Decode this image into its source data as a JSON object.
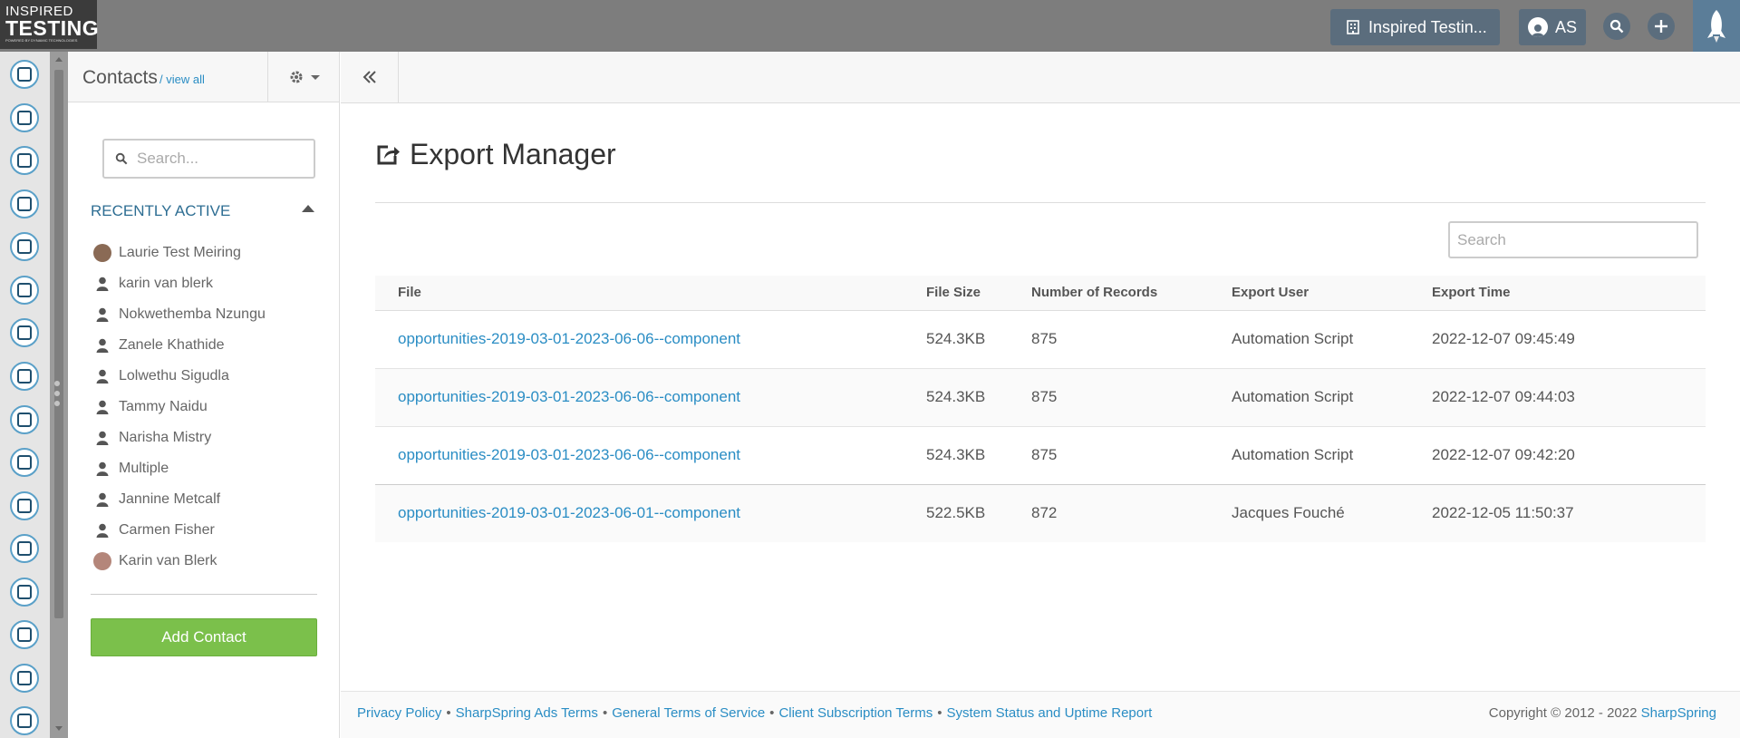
{
  "topbar": {
    "logo_line1": "INSPIRED",
    "logo_line2": "TESTING",
    "logo_tagline": "POWERED BY DYNAMIC TECHNOLOGIES",
    "org_label": "Inspired Testin...",
    "user_initials": "AS"
  },
  "rail": {
    "icons": [
      "contacts-icon",
      "email-icon",
      "clipboard-icon",
      "map-icon",
      "workflow-icon",
      "list-icon",
      "megaphone-icon",
      "chat-icon",
      "thumbs-up-icon",
      "tv-icon",
      "image-icon",
      "calendar-icon",
      "handshake-icon",
      "chart-icon",
      "support-icon",
      "user-settings-icon"
    ]
  },
  "contacts": {
    "title": "Contacts",
    "view_all": "/ view all",
    "search_placeholder": "Search...",
    "recent_heading": "RECENTLY ACTIVE",
    "recent": [
      {
        "name": "Laurie Test Meiring",
        "avatar": "photo"
      },
      {
        "name": "karin van blerk",
        "avatar": "person"
      },
      {
        "name": "Nokwethemba Nzungu",
        "avatar": "person"
      },
      {
        "name": "Zanele Khathide",
        "avatar": "person"
      },
      {
        "name": "Lolwethu Sigudla",
        "avatar": "person"
      },
      {
        "name": "Tammy Naidu",
        "avatar": "person"
      },
      {
        "name": "Narisha Mistry",
        "avatar": "person"
      },
      {
        "name": "Multiple",
        "avatar": "person"
      },
      {
        "name": "Jannine Metcalf",
        "avatar": "person"
      },
      {
        "name": "Carmen Fisher",
        "avatar": "person"
      },
      {
        "name": "Karin van Blerk",
        "avatar": "photo"
      }
    ],
    "add_button": "Add Contact"
  },
  "main": {
    "title": "Export Manager",
    "search_placeholder": "Search",
    "table": {
      "columns": [
        "File",
        "File Size",
        "Number of Records",
        "Export User",
        "Export Time"
      ],
      "rows": [
        {
          "file": "opportunities-2019-03-01-2023-06-06--component",
          "size": "524.3KB",
          "records": "875",
          "user": "Automation Script",
          "time": "2022-12-07 09:45:49"
        },
        {
          "file": "opportunities-2019-03-01-2023-06-06--component",
          "size": "524.3KB",
          "records": "875",
          "user": "Automation Script",
          "time": "2022-12-07 09:44:03"
        },
        {
          "file": "opportunities-2019-03-01-2023-06-06--component",
          "size": "524.3KB",
          "records": "875",
          "user": "Automation Script",
          "time": "2022-12-07 09:42:20"
        },
        {
          "file": "opportunities-2019-03-01-2023-06-01--component",
          "size": "522.5KB",
          "records": "872",
          "user": "Jacques Fouché",
          "time": "2022-12-05 11:50:37"
        }
      ]
    }
  },
  "footer": {
    "links": [
      "Privacy Policy",
      "SharpSpring Ads Terms",
      "General Terms of Service",
      "Client Subscription Terms",
      "System Status and Uptime Report"
    ],
    "separator": "•",
    "copyright": "Copyright © 2012 - 2022",
    "brand": "SharpSpring"
  },
  "colors": {
    "topbar": "#7d7d7d",
    "button_accent": "#5b6d7d",
    "link": "#2a8dc4",
    "add_contact": "#7bc04b"
  }
}
